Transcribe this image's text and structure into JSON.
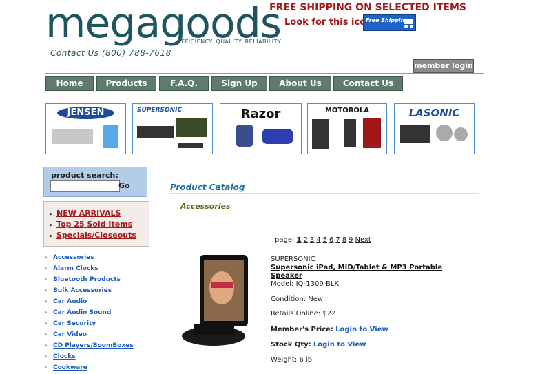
{
  "header": {
    "logo": "megagoods",
    "tagline": "EFFICIENCY. QUALITY. RELIABILITY.",
    "contact": "Contact Us (800) 788-7618",
    "shipping_headline": "FREE SHIPPING ON SELECTED ITEMS",
    "shipping_sub": "Look for this icon",
    "shipping_badge": "Free Shipping",
    "member_login": "member login"
  },
  "nav": [
    {
      "label": "Home"
    },
    {
      "label": "Products"
    },
    {
      "label": "F.A.Q."
    },
    {
      "label": "Sign Up"
    },
    {
      "label": "About Us"
    },
    {
      "label": "Contact Us"
    }
  ],
  "brands": [
    {
      "name": "JENSEN"
    },
    {
      "name": "SUPERSONIC"
    },
    {
      "name": "Razor"
    },
    {
      "name": "MOTOROLA"
    },
    {
      "name": "LASONIC"
    }
  ],
  "search": {
    "label": "product search:",
    "go": "Go"
  },
  "quick_links": [
    "NEW ARRIVALS",
    "Top 25 Sold Items",
    "Specials/Closeouts"
  ],
  "categories": [
    "Accessories",
    "Alarm Clocks",
    "Bluetooth Products",
    "Bulk Accessories",
    "Car Audio",
    "Car Audio Sound",
    "Car Security",
    "Car Video",
    "CD Players/BoomBoxes",
    "Clocks",
    "Cookware"
  ],
  "main": {
    "catalog_title": "Product Catalog",
    "section": "Accessories",
    "pager_label": "page:",
    "pages": [
      "1",
      "2",
      "3",
      "4",
      "5",
      "6",
      "7",
      "8",
      "9"
    ],
    "next": "Next"
  },
  "product": {
    "brand": "SUPERSONIC",
    "title_line1": "Supersonic iPad, MID/Tablet & MP3 Portable",
    "title_line2": "Speaker",
    "model": "Model: IQ-1309-BLK",
    "condition": "Condition: New",
    "retail": "Retails Online: $22",
    "member_price_label": "Member's Price:",
    "member_price_link": "Login to View",
    "stock_label": "Stock Qty:",
    "stock_link": "Login to View",
    "weight": "Weight: 6 lb"
  }
}
